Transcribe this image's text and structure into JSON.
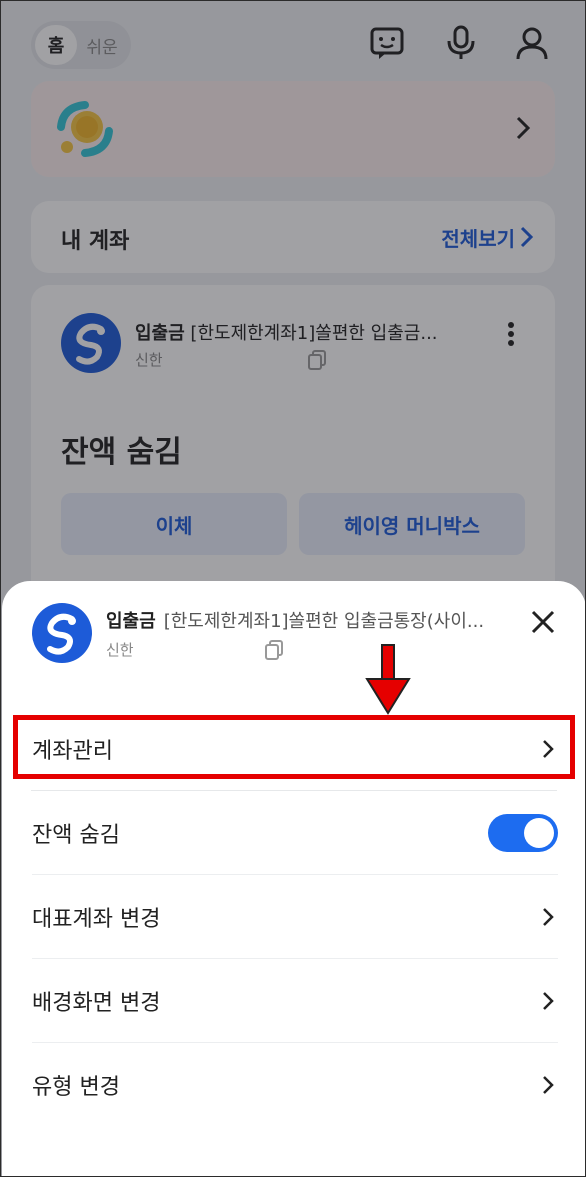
{
  "background": {
    "mode_toggle": {
      "active": "홈",
      "other": "쉬운"
    },
    "top_icons": [
      "chat-icon",
      "mic-icon",
      "profile-icon"
    ],
    "my_accounts": {
      "title": "내 계좌",
      "view_all": "전체보기"
    },
    "account_card": {
      "type": "입출금",
      "name": "[한도제한계좌1]쏠편한 입출금...",
      "bank": "신한",
      "balance_text": "잔액 숨김",
      "buttons": [
        "이체",
        "헤이영 머니박스"
      ]
    }
  },
  "sheet": {
    "account_type": "입출금",
    "account_name": "[한도제한계좌1]쏠편한 입출금통장(사이...",
    "bank": "신한",
    "items": [
      {
        "label": "계좌관리",
        "control": "chevron"
      },
      {
        "label": "잔액 숨김",
        "control": "toggle",
        "toggle_on": true
      },
      {
        "label": "대표계좌 변경",
        "control": "chevron"
      },
      {
        "label": "배경화면 변경",
        "control": "chevron"
      },
      {
        "label": "유형 변경",
        "control": "chevron"
      }
    ]
  },
  "colors": {
    "accent_blue": "#1d6cf0",
    "link_blue": "#1d5bd8",
    "highlight_red": "#e50000",
    "shinhan_blue": "#1d5bd8"
  }
}
